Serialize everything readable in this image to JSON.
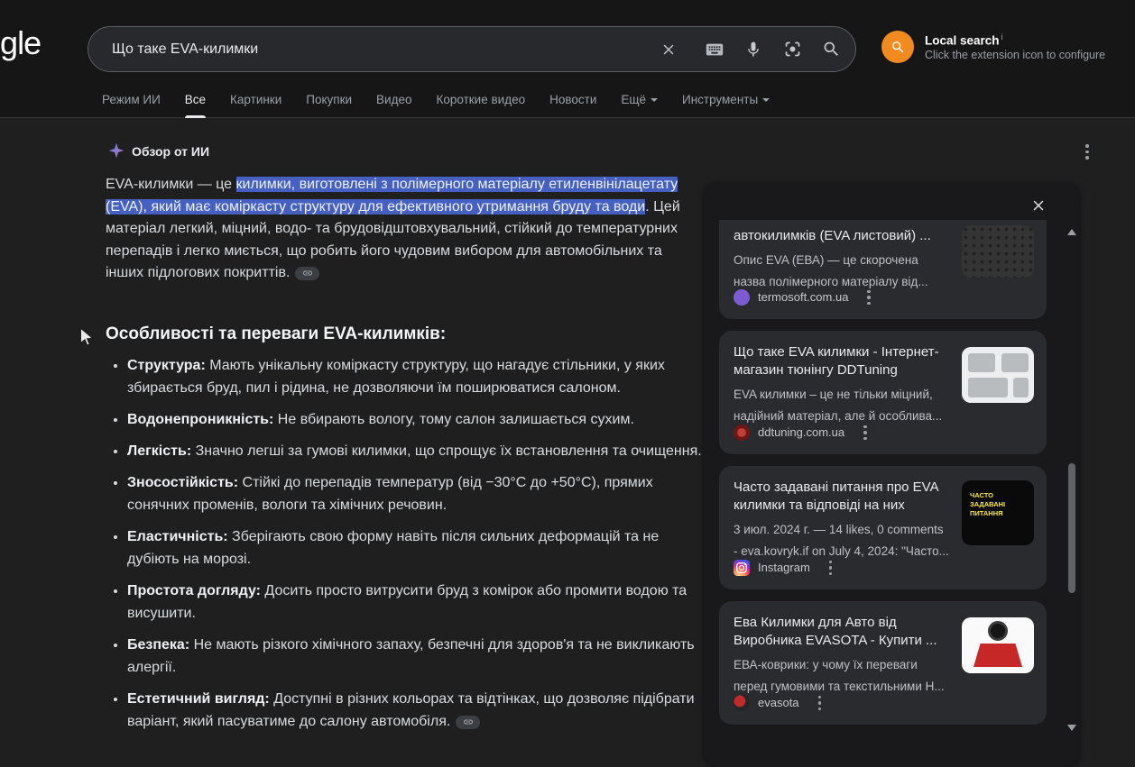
{
  "header": {
    "logo": "Google",
    "search_query": "Що таке EVA-килимки",
    "extension": {
      "title": "Local search",
      "sup": "i",
      "subtitle": "Click the extension icon to configure"
    }
  },
  "tabs": [
    "Режим ИИ",
    "Все",
    "Картинки",
    "Покупки",
    "Видео",
    "Короткие видео",
    "Новости",
    "Ещё",
    "Инструменты"
  ],
  "ai_overview": {
    "label": "Обзор от ИИ",
    "intro": {
      "before": "EVA-килимки — це ",
      "highlight": "килимки, виготовлені з полімерного матеріалу етиленвінілацетату (EVA), який має коміркасту структуру для ефективного утримання бруду та води",
      "after": ". Цей матеріал легкий, міцний, водо- та брудовідштовхувальний, стійкий до температурних перепадів і легко миється, що робить його чудовим вибором для автомобільних та інших підлогових покриттів."
    },
    "heading": "Особливості та переваги EVA-килимків:",
    "bullets": [
      {
        "term": "Структура:",
        "text": " Мають унікальну коміркасту структуру, що нагадує стільники, у яких збирається бруд, пил і рідина, не дозволяючи їм поширюватися салоном."
      },
      {
        "term": "Водонепроникність:",
        "text": " Не вбирають вологу, тому салон залишається сухим."
      },
      {
        "term": "Легкість:",
        "text": " Значно легші за гумові килимки, що спрощує їх встановлення та очищення."
      },
      {
        "term": "Зносостійкість:",
        "text": " Стійкі до перепадів температур (від −30°C до +50°C), прямих сонячних променів, вологи та хімічних речовин."
      },
      {
        "term": "Еластичність:",
        "text": " Зберігають свою форму навіть після сильних деформацій та не дубіють на морозі."
      },
      {
        "term": "Простота догляду:",
        "text": " Досить просто витрусити бруд з комірок або промити водою та висушити."
      },
      {
        "term": "Безпека:",
        "text": " Не мають різкого хімічного запаху, безпечні для здоров'я та не викликають алергії."
      },
      {
        "term": "Естетичний вигляд:",
        "text": " Доступні в різних кольорах та відтінках, що дозволяє підібрати варіант, який пасуватиме до салону автомобіля."
      }
    ]
  },
  "panel": {
    "cards": [
      {
        "title": "автокилимків (EVA листовий) ...",
        "snippet": "Опис EVA (ЕВА) — це скорочена назва полімерного матеріалу від...",
        "source": "termosoft.com.ua"
      },
      {
        "title": "Що таке EVA килимки - Інтернет-магазин тюнінгу DDTuning",
        "snippet": "EVA килимки – це не тільки міцний, надійний матеріал, але й особлива...",
        "source": "ddtuning.com.ua"
      },
      {
        "title": "Часто задавані питання про EVA килимки та відповіді на них",
        "snippet": "3 июл. 2024 г. — 14 likes, 0 comments - eva.kovryk.if on July 4, 2024: \"Часто...",
        "source": "Instagram",
        "thumb_text": "ЧАСТО ЗАДАВАНІ ПИТАННЯ"
      },
      {
        "title": "Ева Килимки для Авто від Виробника EVASOTA - Купити ...",
        "snippet": "ЕВА-коврики: у чому їх переваги перед гумовими та текстильними Н...",
        "source": "evasota"
      }
    ]
  },
  "colors": {
    "selection_blue": "#4560c0",
    "extension_orange": "#f28b1f",
    "page_bg": "#1f1f20",
    "header_bg": "#161617",
    "card_bg": "#2a2b2e"
  }
}
